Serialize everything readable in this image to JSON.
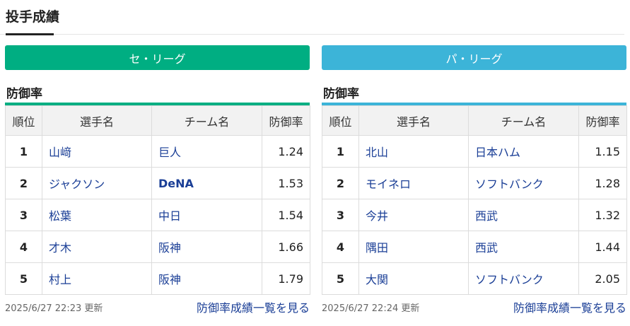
{
  "page": {
    "title": "投手成績"
  },
  "leagues": [
    {
      "name": "セ・リーグ",
      "section_title": "防御率",
      "headers": [
        "順位",
        "選手名",
        "チーム名",
        "防御率"
      ],
      "rows": [
        {
          "rank": "1",
          "player": "山﨑",
          "team": "巨人",
          "era": "1.24"
        },
        {
          "rank": "2",
          "player": "ジャクソン",
          "team": "DeNA",
          "era": "1.53"
        },
        {
          "rank": "3",
          "player": "松葉",
          "team": "中日",
          "era": "1.54"
        },
        {
          "rank": "4",
          "player": "才木",
          "team": "阪神",
          "era": "1.66"
        },
        {
          "rank": "5",
          "player": "村上",
          "team": "阪神",
          "era": "1.79"
        }
      ],
      "updated": "2025/6/27 22:23 更新",
      "more_link": "防御率成績一覧を見る",
      "accent_color": "#00ae82"
    },
    {
      "name": "パ・リーグ",
      "section_title": "防御率",
      "headers": [
        "順位",
        "選手名",
        "チーム名",
        "防御率"
      ],
      "rows": [
        {
          "rank": "1",
          "player": "北山",
          "team": "日本ハム",
          "era": "1.15"
        },
        {
          "rank": "2",
          "player": "モイネロ",
          "team": "ソフトバンク",
          "era": "1.28"
        },
        {
          "rank": "3",
          "player": "今井",
          "team": "西武",
          "era": "1.32"
        },
        {
          "rank": "4",
          "player": "隅田",
          "team": "西武",
          "era": "1.44"
        },
        {
          "rank": "5",
          "player": "大関",
          "team": "ソフトバンク",
          "era": "2.05"
        }
      ],
      "updated": "2025/6/27 22:24 更新",
      "more_link": "防御率成績一覧を見る",
      "accent_color": "#3cb4d8"
    }
  ]
}
